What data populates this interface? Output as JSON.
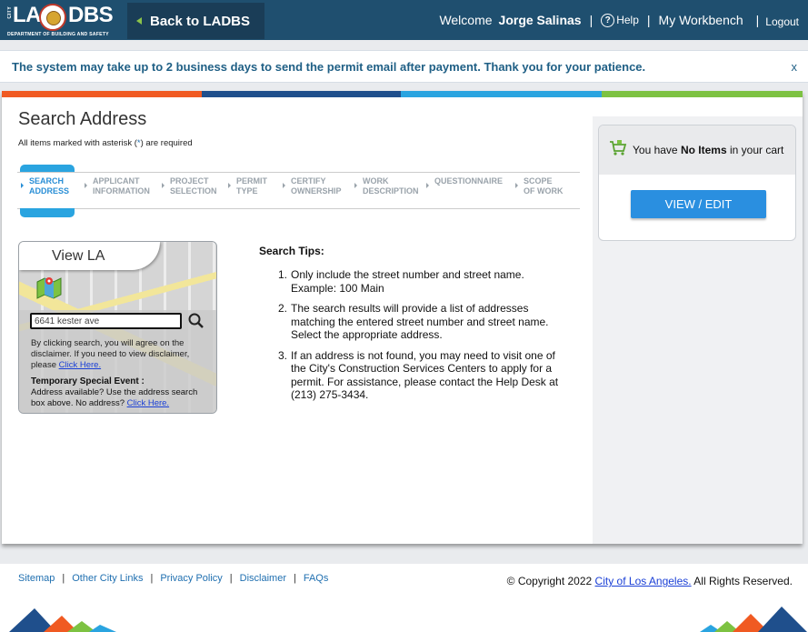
{
  "header": {
    "logo_city": "CITY",
    "logo_text": "LA DBS",
    "logo_dept": "DEPARTMENT OF BUILDING AND SAFETY",
    "back_label": "Back to LADBS",
    "welcome": "Welcome",
    "user_name": "Jorge Salinas",
    "help_label": "Help",
    "workbench_label": "My Workbench",
    "logout_label": "Logout",
    "separator": "|"
  },
  "notice": {
    "message": "The system may take up to 2 business days to send the permit email after payment. Thank you for your patience.",
    "close": "x"
  },
  "page": {
    "title": "Search Address",
    "required_prefix": "All items marked with asterisk (",
    "required_asterisk": "*",
    "required_suffix": ") are required"
  },
  "steps": [
    {
      "line1": "SEARCH",
      "line2": "ADDRESS",
      "active": true
    },
    {
      "line1": "APPLICANT",
      "line2": "INFORMATION"
    },
    {
      "line1": "PROJECT",
      "line2": "SELECTION"
    },
    {
      "line1": "PERMIT",
      "line2": "TYPE"
    },
    {
      "line1": "CERTIFY",
      "line2": "OWNERSHIP"
    },
    {
      "line1": "WORK",
      "line2": "DESCRIPTION"
    },
    {
      "line1": "QUESTIONNAIRE",
      "line2": ""
    },
    {
      "line1": "SCOPE",
      "line2": "OF WORK"
    }
  ],
  "viewla": {
    "title": "View LA",
    "search_value": "6641 kester ave",
    "disclaimer_text": "By clicking search, you will agree on the disclaimer. If you need to view disclaimer, please ",
    "disclaimer_link": "Click Here.",
    "event_title": "Temporary Special Event :",
    "event_text": "Address available? Use the address search box above. No address? ",
    "event_link": "Click Here."
  },
  "tips": {
    "title": "Search Tips:",
    "items": [
      "Only include the street number and street name. Example: 100 Main",
      "The search results will provide a list of addresses matching the entered street number and street name. Select the appropriate address.",
      "If an address is not found, you may need to visit one of the City's Construction Services Centers to apply for a permit. For assistance, please contact the Help Desk at (213) 275-3434."
    ]
  },
  "cart": {
    "prefix": "You have ",
    "count_text": "No Items",
    "suffix": " in your cart",
    "button": "VIEW / EDIT"
  },
  "footer": {
    "links": [
      "Sitemap",
      "Other City Links",
      "Privacy Policy",
      "Disclaimer",
      "FAQs"
    ],
    "copyright_prefix": "© Copyright 2022 ",
    "copyright_link": "City of Los Angeles.",
    "copyright_suffix": " All Rights Reserved."
  },
  "colors": {
    "header_bg": "#1f4f6f",
    "accent_blue": "#2a8fe0",
    "stripe_orange": "#f05a22",
    "stripe_navy": "#1f4f8c",
    "stripe_sky": "#2aa4e0",
    "stripe_green": "#7dc242"
  }
}
